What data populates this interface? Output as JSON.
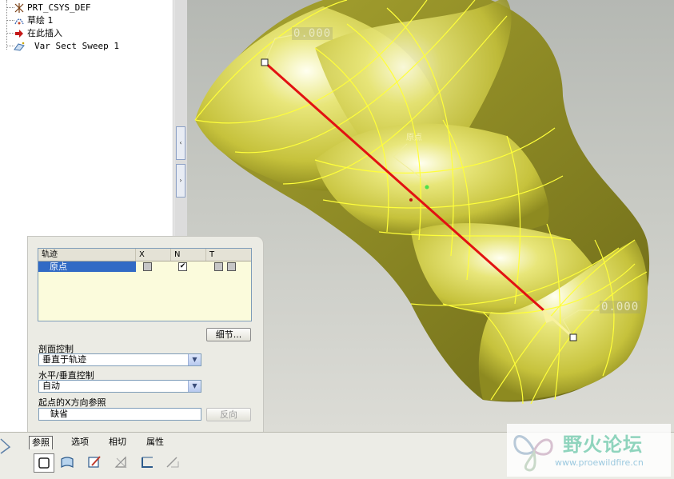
{
  "model_tree": {
    "items": [
      {
        "label": "PRT_CSYS_DEF",
        "icon": "csys-icon"
      },
      {
        "label": "草绘 1",
        "icon": "sketch-icon"
      },
      {
        "label": "在此插入",
        "icon": "insert-here-arrow-icon"
      },
      {
        "label": "Var Sect Sweep 1",
        "icon": "var-sect-sweep-icon"
      }
    ]
  },
  "splitter": {
    "collapse_glyph": "‹",
    "expand_glyph": "›"
  },
  "viewport": {
    "dim_top": "0.000",
    "dim_bottom": "0.000",
    "origin_label": "原点",
    "colors": {
      "model": "#d6d44a",
      "edges": "#ffff40",
      "trajectory": "#e01010"
    }
  },
  "references": {
    "table": {
      "headers": [
        "轨迹",
        "X",
        "N",
        "T"
      ],
      "rows": [
        {
          "name": "原点",
          "x_checked": false,
          "n_checked": true,
          "t_checked": false
        }
      ]
    },
    "details_button": "细节...",
    "section_control_label": "剖面控制",
    "section_control_value": "垂直于轨迹",
    "hv_control_label": "水平/垂直控制",
    "hv_control_value": "自动",
    "x_dir_label": "起点的X方向参照",
    "x_dir_value": "缺省",
    "flip_button": "反向"
  },
  "dashboard": {
    "tabs": [
      "参照",
      "选项",
      "相切",
      "属性"
    ],
    "active_tab": "参照",
    "icons": [
      "solid-icon",
      "surface-icon",
      "sketch-edit-icon",
      "remove-material-icon",
      "thicken-icon",
      "remove-thicken-icon"
    ]
  },
  "watermark": {
    "title": "野火论坛",
    "url": "www.proewildfire.cn"
  }
}
